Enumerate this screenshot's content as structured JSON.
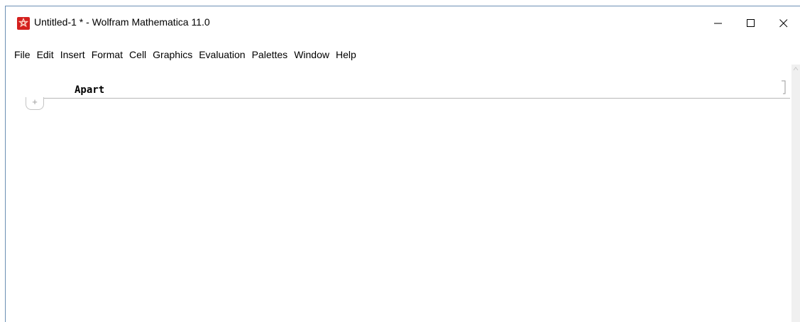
{
  "window": {
    "title": "Untitled-1 * - Wolfram Mathematica 11.0",
    "icon": "mathematica-app-icon",
    "controls": {
      "minimize_icon": "minimize-icon",
      "maximize_icon": "maximize-icon",
      "close_icon": "close-icon"
    }
  },
  "menubar": {
    "items": [
      {
        "label": "File"
      },
      {
        "label": "Edit"
      },
      {
        "label": "Insert"
      },
      {
        "label": "Format"
      },
      {
        "label": "Cell"
      },
      {
        "label": "Graphics"
      },
      {
        "label": "Evaluation"
      },
      {
        "label": "Palettes"
      },
      {
        "label": "Window"
      },
      {
        "label": "Help"
      }
    ]
  },
  "notebook": {
    "cell_text": "Apart",
    "insert_button_label": "+"
  },
  "colors": {
    "icon_red": "#d4201e",
    "window_border": "#6b8fb4",
    "insertion_line": "#b8b8b8"
  }
}
